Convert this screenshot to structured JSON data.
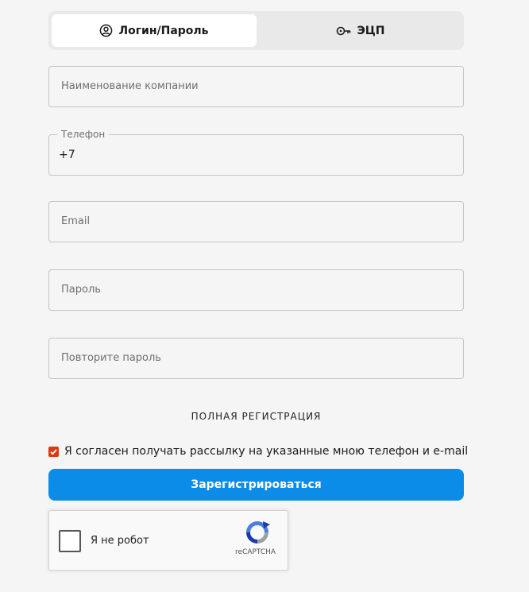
{
  "tabs": {
    "login": {
      "label": "Логин/Пароль",
      "icon": "user-circle-icon"
    },
    "ecp": {
      "label": "ЭЦП",
      "icon": "key-icon"
    }
  },
  "fields": {
    "company": {
      "placeholder": "Наименование компании"
    },
    "phone": {
      "label": "Телефон",
      "value": "+7"
    },
    "email": {
      "placeholder": "Email"
    },
    "password": {
      "placeholder": "Пароль"
    },
    "password_repeat": {
      "placeholder": "Повторите пароль"
    }
  },
  "section_title": "ПОЛНАЯ РЕГИСТРАЦИЯ",
  "consent": {
    "checked": true,
    "label": "Я согласен получать рассылку на указанные мною телефон и e-mail"
  },
  "submit_label": "Зарегистрироваться",
  "recaptcha": {
    "label": "Я не робот",
    "brand": "reCAPTCHA"
  },
  "colors": {
    "accent": "#0a8ce8",
    "checkbox": "#d93a10",
    "background": "#f5f5f5"
  }
}
